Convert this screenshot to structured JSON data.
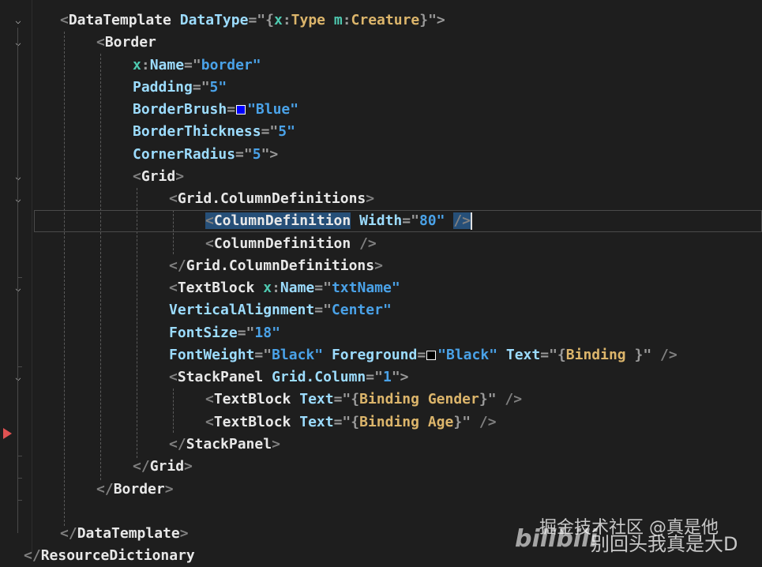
{
  "editor": {
    "language": "xaml",
    "colors": {
      "background": "#1e1e1e",
      "punctuation": "#808080",
      "tag": "#e8e8e8",
      "attribute": "#9cdcfe",
      "value": "#4aa2e8",
      "namespace_prefix": "#4ec9b0",
      "markup_extension": "#dcb56b",
      "selection": "#264f78",
      "breakpoint_arrow": "#e05252",
      "blue_swatch": "#0000ff",
      "black_swatch": "#000000"
    },
    "lines": {
      "l1": [
        "<",
        "DataTemplate",
        "DataType",
        "=\"",
        "{",
        "x",
        ":",
        "Type",
        "m",
        ":",
        "Creature",
        "}",
        "\">"
      ],
      "l2": [
        "<",
        "Border"
      ],
      "l3": [
        "x",
        ":",
        "Name",
        "=\"",
        "border",
        "\""
      ],
      "l4": [
        "Padding",
        "=\"",
        "5",
        "\""
      ],
      "l5": [
        "BorderBrush",
        "=",
        "\"",
        "Blue",
        "\""
      ],
      "l6": [
        "BorderThickness",
        "=\"",
        "5",
        "\""
      ],
      "l7": [
        "CornerRadius",
        "=\"",
        "5",
        "\">"
      ],
      "l8": [
        "<",
        "Grid",
        ">"
      ],
      "l9": [
        "<",
        "Grid.ColumnDefinitions",
        ">"
      ],
      "l10": [
        "<",
        "ColumnDefinition",
        "Width",
        "=\"",
        "80",
        "\"",
        "/>"
      ],
      "l11": [
        "<",
        "ColumnDefinition",
        "/>"
      ],
      "l12": [
        "</",
        "Grid.ColumnDefinitions",
        ">"
      ],
      "l13": [
        "<",
        "TextBlock",
        "x",
        ":",
        "Name",
        "=\"",
        "txtName",
        "\""
      ],
      "l14": [
        "VerticalAlignment",
        "=\"",
        "Center",
        "\""
      ],
      "l15": [
        "FontSize",
        "=\"",
        "18",
        "\""
      ],
      "l16": [
        "FontWeight",
        "=\"",
        "Black",
        "\"",
        "Foreground",
        "=",
        "\"",
        "Black",
        "\"",
        "Text",
        "=\"",
        "{",
        "Binding",
        "}",
        "\"",
        "/>"
      ],
      "l17": [
        "<",
        "StackPanel",
        "Grid.Column",
        "=\"",
        "1",
        "\">"
      ],
      "l18": [
        "<",
        "TextBlock",
        "Text",
        "=\"",
        "{",
        "Binding",
        "Gender",
        "}",
        "\"",
        "/>"
      ],
      "l19": [
        "<",
        "TextBlock",
        "Text",
        "=\"",
        "{",
        "Binding",
        "Age",
        "}",
        "\"",
        "/>"
      ],
      "l20": [
        "</",
        "StackPanel",
        ">"
      ],
      "l21": [
        "</",
        "Grid",
        ">"
      ],
      "l22": [
        "</",
        "Border",
        ">"
      ],
      "l23": [
        "</",
        "DataTemplate",
        ">"
      ],
      "l24": [
        "</",
        "ResourceDictionary"
      ]
    }
  },
  "gutter": {
    "fold_icon": "chevron-down-icon",
    "fold_glyph": "⌵",
    "breakpoint_icon": "breakpoint-arrow-icon"
  },
  "watermark": {
    "top": "掘金技术社区 @真是他",
    "logo": "bilibili",
    "bottom": "别回头我真是大D"
  }
}
